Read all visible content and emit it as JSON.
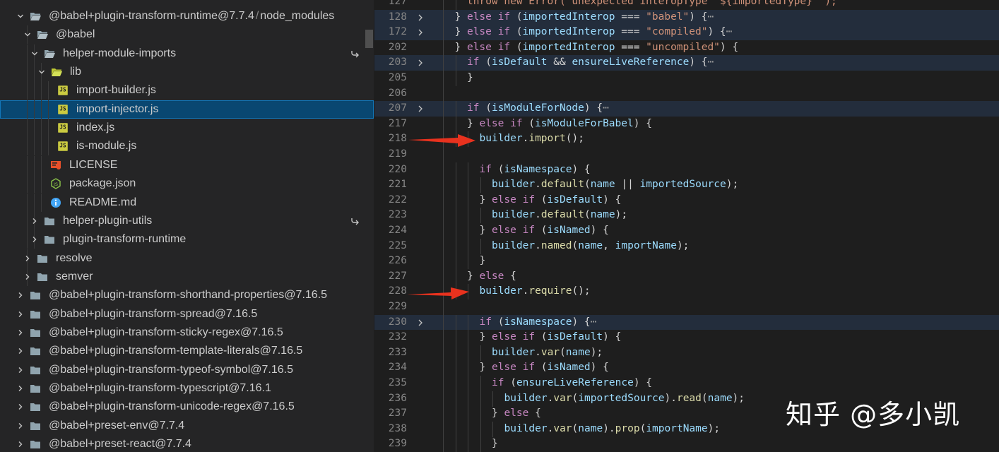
{
  "explorer": {
    "items": [
      {
        "label": "@babel+plugin-transform-runtime@7.7.4",
        "sep": "/",
        "sub": "node_modules",
        "depth": 0,
        "kind": "folder-open",
        "chevron": "down",
        "icon": "folder-open-icon"
      },
      {
        "label": "@babel",
        "depth": 1,
        "kind": "folder-open",
        "chevron": "down",
        "icon": "folder-open-icon"
      },
      {
        "label": "helper-module-imports",
        "depth": 2,
        "kind": "folder-open",
        "chevron": "down",
        "icon": "folder-open-icon",
        "link": true
      },
      {
        "label": "lib",
        "depth": 3,
        "kind": "lib-folder",
        "chevron": "down",
        "icon": "lib-folder-icon"
      },
      {
        "label": "import-builder.js",
        "depth": 4,
        "kind": "js",
        "icon": "js-file-icon"
      },
      {
        "label": "import-injector.js",
        "depth": 4,
        "kind": "js",
        "icon": "js-file-icon",
        "selected": true
      },
      {
        "label": "index.js",
        "depth": 4,
        "kind": "js",
        "icon": "js-file-icon"
      },
      {
        "label": "is-module.js",
        "depth": 4,
        "kind": "js",
        "icon": "js-file-icon"
      },
      {
        "label": "LICENSE",
        "depth": 3,
        "kind": "license",
        "icon": "license-icon"
      },
      {
        "label": "package.json",
        "depth": 3,
        "kind": "node",
        "icon": "nodejs-icon"
      },
      {
        "label": "README.md",
        "depth": 3,
        "kind": "info",
        "icon": "info-icon"
      },
      {
        "label": "helper-plugin-utils",
        "depth": 2,
        "kind": "folder",
        "chevron": "right",
        "icon": "folder-icon",
        "link": true
      },
      {
        "label": "plugin-transform-runtime",
        "depth": 2,
        "kind": "folder",
        "chevron": "right",
        "icon": "folder-icon"
      },
      {
        "label": "resolve",
        "depth": 1,
        "kind": "folder",
        "chevron": "right",
        "icon": "folder-icon"
      },
      {
        "label": "semver",
        "depth": 1,
        "kind": "folder",
        "chevron": "right",
        "icon": "folder-icon"
      },
      {
        "label": "@babel+plugin-transform-shorthand-properties@7.16.5",
        "depth": 0,
        "kind": "folder",
        "chevron": "right",
        "icon": "folder-icon"
      },
      {
        "label": "@babel+plugin-transform-spread@7.16.5",
        "depth": 0,
        "kind": "folder",
        "chevron": "right",
        "icon": "folder-icon"
      },
      {
        "label": "@babel+plugin-transform-sticky-regex@7.16.5",
        "depth": 0,
        "kind": "folder",
        "chevron": "right",
        "icon": "folder-icon"
      },
      {
        "label": "@babel+plugin-transform-template-literals@7.16.5",
        "depth": 0,
        "kind": "folder",
        "chevron": "right",
        "icon": "folder-icon"
      },
      {
        "label": "@babel+plugin-transform-typeof-symbol@7.16.5",
        "depth": 0,
        "kind": "folder",
        "chevron": "right",
        "icon": "folder-icon"
      },
      {
        "label": "@babel+plugin-transform-typescript@7.16.1",
        "depth": 0,
        "kind": "folder",
        "chevron": "right",
        "icon": "folder-icon"
      },
      {
        "label": "@babel+plugin-transform-unicode-regex@7.16.5",
        "depth": 0,
        "kind": "folder",
        "chevron": "right",
        "icon": "folder-icon"
      },
      {
        "label": "@babel+preset-env@7.7.4",
        "depth": 0,
        "kind": "folder",
        "chevron": "right",
        "icon": "folder-icon"
      },
      {
        "label": "@babel+preset-react@7.7.4",
        "depth": 0,
        "kind": "folder",
        "chevron": "right",
        "icon": "folder-icon"
      }
    ]
  },
  "editor": {
    "lines": [
      {
        "n": "127",
        "indent": 2,
        "tokens": [
          [
            "t",
            "throw new Error(`unexpected interopType \"${importedType}\"`);"
          ]
        ]
      },
      {
        "n": "128",
        "indent": 1,
        "fold": true,
        "hl": true,
        "tokens": [
          [
            "p",
            "} "
          ],
          [
            "c",
            "else if"
          ],
          [
            "p",
            " ("
          ],
          [
            "v",
            "importedInterop"
          ],
          [
            "p",
            " === "
          ],
          [
            "s",
            "\"babel\""
          ],
          [
            "p",
            ") {"
          ],
          [
            "d",
            "⋯"
          ]
        ]
      },
      {
        "n": "172",
        "indent": 1,
        "fold": true,
        "hl": true,
        "tokens": [
          [
            "p",
            "} "
          ],
          [
            "c",
            "else if"
          ],
          [
            "p",
            " ("
          ],
          [
            "v",
            "importedInterop"
          ],
          [
            "p",
            " === "
          ],
          [
            "s",
            "\"compiled\""
          ],
          [
            "p",
            ") {"
          ],
          [
            "d",
            "⋯"
          ]
        ]
      },
      {
        "n": "202",
        "indent": 1,
        "tokens": [
          [
            "p",
            "} "
          ],
          [
            "c",
            "else if"
          ],
          [
            "p",
            " ("
          ],
          [
            "v",
            "importedInterop"
          ],
          [
            "p",
            " === "
          ],
          [
            "s",
            "\"uncompiled\""
          ],
          [
            "p",
            ") {"
          ]
        ]
      },
      {
        "n": "203",
        "indent": 2,
        "fold": true,
        "hl": true,
        "tokens": [
          [
            "c",
            "if"
          ],
          [
            "p",
            " ("
          ],
          [
            "v",
            "isDefault"
          ],
          [
            "p",
            " && "
          ],
          [
            "v",
            "ensureLiveReference"
          ],
          [
            "p",
            ") {"
          ],
          [
            "d",
            "⋯"
          ]
        ]
      },
      {
        "n": "205",
        "indent": 2,
        "tokens": [
          [
            "p",
            "}"
          ]
        ]
      },
      {
        "n": "206",
        "indent": 0,
        "tokens": []
      },
      {
        "n": "207",
        "indent": 2,
        "fold": true,
        "hl": true,
        "tokens": [
          [
            "c",
            "if"
          ],
          [
            "p",
            " ("
          ],
          [
            "v",
            "isModuleForNode"
          ],
          [
            "p",
            ") {"
          ],
          [
            "d",
            "⋯"
          ]
        ]
      },
      {
        "n": "217",
        "indent": 2,
        "tokens": [
          [
            "p",
            "} "
          ],
          [
            "c",
            "else if"
          ],
          [
            "p",
            " ("
          ],
          [
            "v",
            "isModuleForBabel"
          ],
          [
            "p",
            ") {"
          ]
        ]
      },
      {
        "n": "218",
        "indent": 3,
        "tokens": [
          [
            "v",
            "builder"
          ],
          [
            "p",
            "."
          ],
          [
            "f",
            "import"
          ],
          [
            "p",
            "();"
          ]
        ]
      },
      {
        "n": "219",
        "indent": 0,
        "tokens": []
      },
      {
        "n": "220",
        "indent": 3,
        "tokens": [
          [
            "c",
            "if"
          ],
          [
            "p",
            " ("
          ],
          [
            "v",
            "isNamespace"
          ],
          [
            "p",
            ") {"
          ]
        ]
      },
      {
        "n": "221",
        "indent": 4,
        "tokens": [
          [
            "v",
            "builder"
          ],
          [
            "p",
            "."
          ],
          [
            "f",
            "default"
          ],
          [
            "p",
            "("
          ],
          [
            "v",
            "name"
          ],
          [
            "p",
            " || "
          ],
          [
            "v",
            "importedSource"
          ],
          [
            "p",
            ");"
          ]
        ]
      },
      {
        "n": "222",
        "indent": 3,
        "tokens": [
          [
            "p",
            "} "
          ],
          [
            "c",
            "else if"
          ],
          [
            "p",
            " ("
          ],
          [
            "v",
            "isDefault"
          ],
          [
            "p",
            ") {"
          ]
        ]
      },
      {
        "n": "223",
        "indent": 4,
        "tokens": [
          [
            "v",
            "builder"
          ],
          [
            "p",
            "."
          ],
          [
            "f",
            "default"
          ],
          [
            "p",
            "("
          ],
          [
            "v",
            "name"
          ],
          [
            "p",
            ");"
          ]
        ]
      },
      {
        "n": "224",
        "indent": 3,
        "tokens": [
          [
            "p",
            "} "
          ],
          [
            "c",
            "else if"
          ],
          [
            "p",
            " ("
          ],
          [
            "v",
            "isNamed"
          ],
          [
            "p",
            ") {"
          ]
        ]
      },
      {
        "n": "225",
        "indent": 4,
        "tokens": [
          [
            "v",
            "builder"
          ],
          [
            "p",
            "."
          ],
          [
            "f",
            "named"
          ],
          [
            "p",
            "("
          ],
          [
            "v",
            "name"
          ],
          [
            "p",
            ", "
          ],
          [
            "v",
            "importName"
          ],
          [
            "p",
            ");"
          ]
        ]
      },
      {
        "n": "226",
        "indent": 3,
        "tokens": [
          [
            "p",
            "}"
          ]
        ]
      },
      {
        "n": "227",
        "indent": 2,
        "tokens": [
          [
            "p",
            "} "
          ],
          [
            "c",
            "else"
          ],
          [
            "p",
            " {"
          ]
        ]
      },
      {
        "n": "228",
        "indent": 3,
        "tokens": [
          [
            "v",
            "builder"
          ],
          [
            "p",
            "."
          ],
          [
            "f",
            "require"
          ],
          [
            "p",
            "();"
          ]
        ]
      },
      {
        "n": "229",
        "indent": 0,
        "tokens": []
      },
      {
        "n": "230",
        "indent": 3,
        "fold": true,
        "hl": true,
        "tokens": [
          [
            "c",
            "if"
          ],
          [
            "p",
            " ("
          ],
          [
            "v",
            "isNamespace"
          ],
          [
            "p",
            ") {"
          ],
          [
            "d",
            "⋯"
          ]
        ]
      },
      {
        "n": "232",
        "indent": 3,
        "tokens": [
          [
            "p",
            "} "
          ],
          [
            "c",
            "else if"
          ],
          [
            "p",
            " ("
          ],
          [
            "v",
            "isDefault"
          ],
          [
            "p",
            ") {"
          ]
        ]
      },
      {
        "n": "233",
        "indent": 4,
        "tokens": [
          [
            "v",
            "builder"
          ],
          [
            "p",
            "."
          ],
          [
            "f",
            "var"
          ],
          [
            "p",
            "("
          ],
          [
            "v",
            "name"
          ],
          [
            "p",
            ");"
          ]
        ]
      },
      {
        "n": "234",
        "indent": 3,
        "tokens": [
          [
            "p",
            "} "
          ],
          [
            "c",
            "else if"
          ],
          [
            "p",
            " ("
          ],
          [
            "v",
            "isNamed"
          ],
          [
            "p",
            ") {"
          ]
        ]
      },
      {
        "n": "235",
        "indent": 4,
        "tokens": [
          [
            "c",
            "if"
          ],
          [
            "p",
            " ("
          ],
          [
            "v",
            "ensureLiveReference"
          ],
          [
            "p",
            ") {"
          ]
        ]
      },
      {
        "n": "236",
        "indent": 5,
        "tokens": [
          [
            "v",
            "builder"
          ],
          [
            "p",
            "."
          ],
          [
            "f",
            "var"
          ],
          [
            "p",
            "("
          ],
          [
            "v",
            "importedSource"
          ],
          [
            "p",
            ")."
          ],
          [
            "f",
            "read"
          ],
          [
            "p",
            "("
          ],
          [
            "v",
            "name"
          ],
          [
            "p",
            ");"
          ]
        ]
      },
      {
        "n": "237",
        "indent": 4,
        "tokens": [
          [
            "p",
            "} "
          ],
          [
            "c",
            "else"
          ],
          [
            "p",
            " {"
          ]
        ]
      },
      {
        "n": "238",
        "indent": 5,
        "tokens": [
          [
            "v",
            "builder"
          ],
          [
            "p",
            "."
          ],
          [
            "f",
            "var"
          ],
          [
            "p",
            "("
          ],
          [
            "v",
            "name"
          ],
          [
            "p",
            ")."
          ],
          [
            "f",
            "prop"
          ],
          [
            "p",
            "("
          ],
          [
            "v",
            "importName"
          ],
          [
            "p",
            ");"
          ]
        ]
      },
      {
        "n": "239",
        "indent": 4,
        "tokens": [
          [
            "p",
            "}"
          ]
        ]
      }
    ]
  },
  "annotations": {
    "arrow_lines": [
      "218",
      "228"
    ]
  },
  "watermark": "知乎 @多小凯",
  "colors": {
    "keyword": "#569cd6",
    "control": "#c586c0",
    "variable": "#9cdcfe",
    "function": "#dcdcaa",
    "string": "#ce9178",
    "arrow": "#e8321e",
    "selection": "#094771"
  }
}
